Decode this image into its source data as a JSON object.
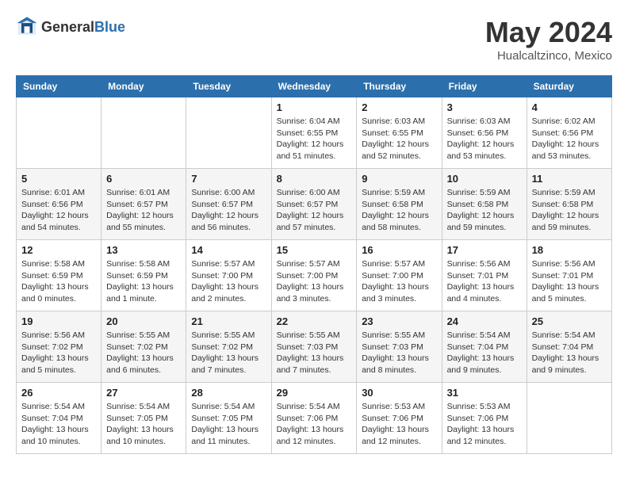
{
  "header": {
    "logo_general": "General",
    "logo_blue": "Blue",
    "month_title": "May 2024",
    "location": "Hualcaltzinco, Mexico"
  },
  "weekdays": [
    "Sunday",
    "Monday",
    "Tuesday",
    "Wednesday",
    "Thursday",
    "Friday",
    "Saturday"
  ],
  "weeks": [
    [
      {
        "day": "",
        "info": ""
      },
      {
        "day": "",
        "info": ""
      },
      {
        "day": "",
        "info": ""
      },
      {
        "day": "1",
        "info": "Sunrise: 6:04 AM\nSunset: 6:55 PM\nDaylight: 12 hours\nand 51 minutes."
      },
      {
        "day": "2",
        "info": "Sunrise: 6:03 AM\nSunset: 6:55 PM\nDaylight: 12 hours\nand 52 minutes."
      },
      {
        "day": "3",
        "info": "Sunrise: 6:03 AM\nSunset: 6:56 PM\nDaylight: 12 hours\nand 53 minutes."
      },
      {
        "day": "4",
        "info": "Sunrise: 6:02 AM\nSunset: 6:56 PM\nDaylight: 12 hours\nand 53 minutes."
      }
    ],
    [
      {
        "day": "5",
        "info": "Sunrise: 6:01 AM\nSunset: 6:56 PM\nDaylight: 12 hours\nand 54 minutes."
      },
      {
        "day": "6",
        "info": "Sunrise: 6:01 AM\nSunset: 6:57 PM\nDaylight: 12 hours\nand 55 minutes."
      },
      {
        "day": "7",
        "info": "Sunrise: 6:00 AM\nSunset: 6:57 PM\nDaylight: 12 hours\nand 56 minutes."
      },
      {
        "day": "8",
        "info": "Sunrise: 6:00 AM\nSunset: 6:57 PM\nDaylight: 12 hours\nand 57 minutes."
      },
      {
        "day": "9",
        "info": "Sunrise: 5:59 AM\nSunset: 6:58 PM\nDaylight: 12 hours\nand 58 minutes."
      },
      {
        "day": "10",
        "info": "Sunrise: 5:59 AM\nSunset: 6:58 PM\nDaylight: 12 hours\nand 59 minutes."
      },
      {
        "day": "11",
        "info": "Sunrise: 5:59 AM\nSunset: 6:58 PM\nDaylight: 12 hours\nand 59 minutes."
      }
    ],
    [
      {
        "day": "12",
        "info": "Sunrise: 5:58 AM\nSunset: 6:59 PM\nDaylight: 13 hours\nand 0 minutes."
      },
      {
        "day": "13",
        "info": "Sunrise: 5:58 AM\nSunset: 6:59 PM\nDaylight: 13 hours\nand 1 minute."
      },
      {
        "day": "14",
        "info": "Sunrise: 5:57 AM\nSunset: 7:00 PM\nDaylight: 13 hours\nand 2 minutes."
      },
      {
        "day": "15",
        "info": "Sunrise: 5:57 AM\nSunset: 7:00 PM\nDaylight: 13 hours\nand 3 minutes."
      },
      {
        "day": "16",
        "info": "Sunrise: 5:57 AM\nSunset: 7:00 PM\nDaylight: 13 hours\nand 3 minutes."
      },
      {
        "day": "17",
        "info": "Sunrise: 5:56 AM\nSunset: 7:01 PM\nDaylight: 13 hours\nand 4 minutes."
      },
      {
        "day": "18",
        "info": "Sunrise: 5:56 AM\nSunset: 7:01 PM\nDaylight: 13 hours\nand 5 minutes."
      }
    ],
    [
      {
        "day": "19",
        "info": "Sunrise: 5:56 AM\nSunset: 7:02 PM\nDaylight: 13 hours\nand 5 minutes."
      },
      {
        "day": "20",
        "info": "Sunrise: 5:55 AM\nSunset: 7:02 PM\nDaylight: 13 hours\nand 6 minutes."
      },
      {
        "day": "21",
        "info": "Sunrise: 5:55 AM\nSunset: 7:02 PM\nDaylight: 13 hours\nand 7 minutes."
      },
      {
        "day": "22",
        "info": "Sunrise: 5:55 AM\nSunset: 7:03 PM\nDaylight: 13 hours\nand 7 minutes."
      },
      {
        "day": "23",
        "info": "Sunrise: 5:55 AM\nSunset: 7:03 PM\nDaylight: 13 hours\nand 8 minutes."
      },
      {
        "day": "24",
        "info": "Sunrise: 5:54 AM\nSunset: 7:04 PM\nDaylight: 13 hours\nand 9 minutes."
      },
      {
        "day": "25",
        "info": "Sunrise: 5:54 AM\nSunset: 7:04 PM\nDaylight: 13 hours\nand 9 minutes."
      }
    ],
    [
      {
        "day": "26",
        "info": "Sunrise: 5:54 AM\nSunset: 7:04 PM\nDaylight: 13 hours\nand 10 minutes."
      },
      {
        "day": "27",
        "info": "Sunrise: 5:54 AM\nSunset: 7:05 PM\nDaylight: 13 hours\nand 10 minutes."
      },
      {
        "day": "28",
        "info": "Sunrise: 5:54 AM\nSunset: 7:05 PM\nDaylight: 13 hours\nand 11 minutes."
      },
      {
        "day": "29",
        "info": "Sunrise: 5:54 AM\nSunset: 7:06 PM\nDaylight: 13 hours\nand 12 minutes."
      },
      {
        "day": "30",
        "info": "Sunrise: 5:53 AM\nSunset: 7:06 PM\nDaylight: 13 hours\nand 12 minutes."
      },
      {
        "day": "31",
        "info": "Sunrise: 5:53 AM\nSunset: 7:06 PM\nDaylight: 13 hours\nand 12 minutes."
      },
      {
        "day": "",
        "info": ""
      }
    ]
  ]
}
